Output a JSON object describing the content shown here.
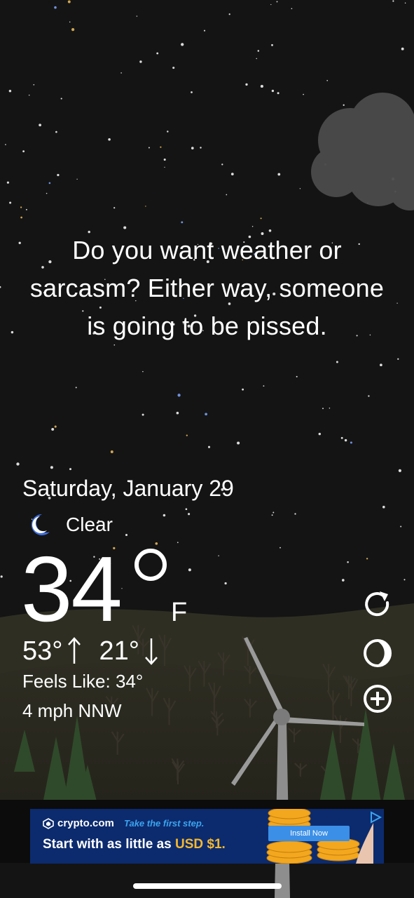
{
  "quote": "Do you want weather or sarcasm? Either way, someone is going to be pissed.",
  "date": "Saturday, January 29",
  "condition": {
    "label": "Clear",
    "icon": "moon-icon"
  },
  "temperature": {
    "value": "34",
    "unit": "F"
  },
  "high": "53°",
  "low": "21°",
  "feels_like": "Feels Like: 34°",
  "wind": "4 mph NNW",
  "side_buttons": [
    "refresh-icon",
    "theme-icon",
    "add-location-icon"
  ],
  "ad": {
    "brand": "crypto.com",
    "tagline": "Take the first step.",
    "headline_prefix": "Start with as little as ",
    "headline_amount": "USD $1.",
    "cta": "Install Now"
  },
  "colors": {
    "background": "#141414",
    "moon": "#3d6ee0",
    "ad_bg": "#0c2b6e",
    "ad_accent": "#f5b82e"
  }
}
